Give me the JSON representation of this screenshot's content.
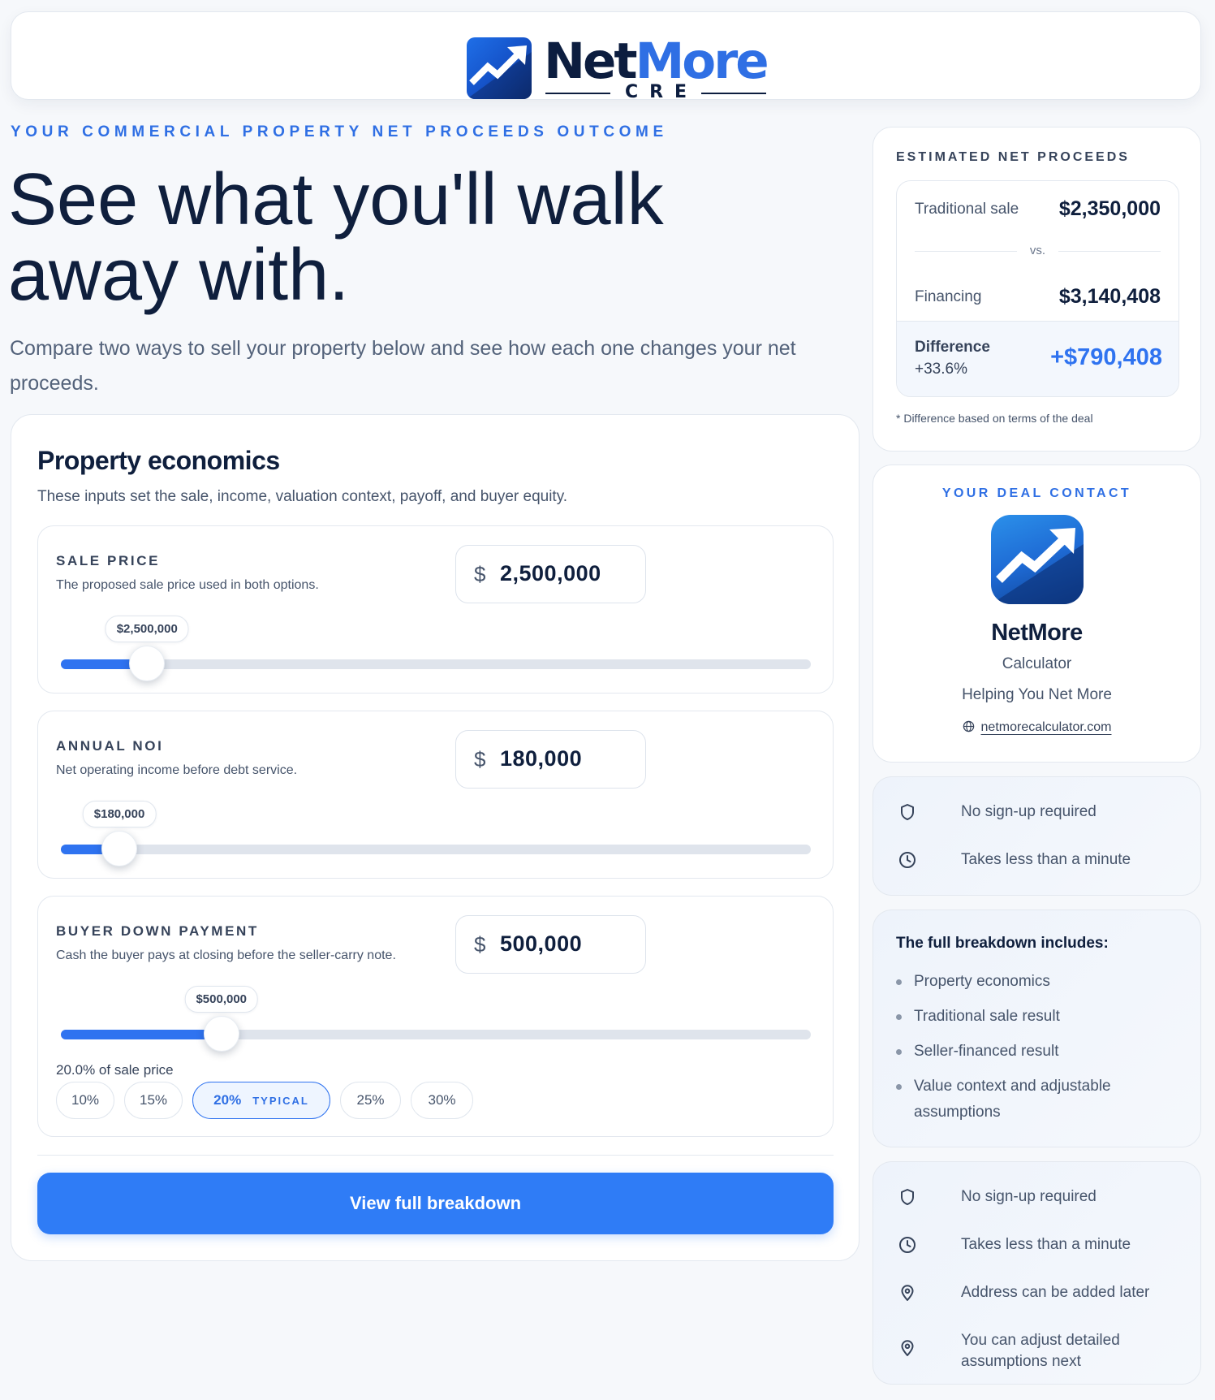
{
  "header": {
    "logo_primary": "Net",
    "logo_accent": "More",
    "logo_sub": "CRE"
  },
  "hero": {
    "eyebrow": "YOUR COMMERCIAL PROPERTY NET PROCEEDS OUTCOME",
    "title": "See what you'll walk away with.",
    "subtitle": "Compare two ways to sell your property below and see how each one changes your net proceeds."
  },
  "economics": {
    "title": "Property economics",
    "description": "These inputs set the sale, income, valuation context, payoff, and buyer equity.",
    "fields": [
      {
        "label": "SALE PRICE",
        "help": "The proposed sale price used in both options.",
        "currency": "$",
        "value": "2,500,000",
        "slider_bubble": "$2,500,000",
        "slider_position": 0.115
      },
      {
        "label": "ANNUAL NOI",
        "help": "Net operating income before debt service.",
        "currency": "$",
        "value": "180,000",
        "slider_bubble": "$180,000",
        "slider_position": 0.078
      },
      {
        "label": "BUYER DOWN PAYMENT",
        "help": "Cash the buyer pays at closing before the seller-carry note.",
        "currency": "$",
        "value": "500,000",
        "slider_bubble": "$500,000",
        "slider_position": 0.214,
        "percent_note": "20.0% of sale price",
        "chips": [
          {
            "label": "10%"
          },
          {
            "label": "15%"
          },
          {
            "label": "20%",
            "badge": "TYPICAL",
            "selected": true
          },
          {
            "label": "25%"
          },
          {
            "label": "30%"
          }
        ]
      }
    ],
    "cta_label": "View full breakdown"
  },
  "estimate": {
    "eyebrow": "ESTIMATED NET PROCEEDS",
    "traditional_label": "Traditional sale",
    "traditional_value": "$2,350,000",
    "vs_label": "vs.",
    "financing_label": "Financing",
    "financing_value": "$3,140,408",
    "difference_label": "Difference",
    "difference_percent": "+33.6%",
    "difference_value": "+$790,408",
    "note": "* Difference based on terms of the deal"
  },
  "contact": {
    "eyebrow": "YOUR DEAL CONTACT",
    "name": "NetMore",
    "role": "Calculator",
    "tagline": "Helping You Net More",
    "website": "netmorecalculator.com"
  },
  "quick_features": [
    {
      "icon": "shield-icon",
      "text": "No sign-up required"
    },
    {
      "icon": "clock-icon",
      "text": "Takes less than a minute"
    }
  ],
  "breakdown": {
    "title": "The full breakdown includes:",
    "items": [
      "Property economics",
      "Traditional sale result",
      "Seller-financed result",
      "Value context and adjustable assumptions"
    ]
  },
  "features": [
    {
      "icon": "shield-icon",
      "text": "No sign-up required"
    },
    {
      "icon": "clock-icon",
      "text": "Takes less than a minute"
    },
    {
      "icon": "map-pin-icon",
      "text": "Address can be added later"
    },
    {
      "icon": "map-pin-icon",
      "text": "You can adjust detailed assumptions next"
    }
  ],
  "colors": {
    "accent": "#2f73f0",
    "brand_navy": "#0c1d3f",
    "page_bg": "#f6f8fb"
  }
}
